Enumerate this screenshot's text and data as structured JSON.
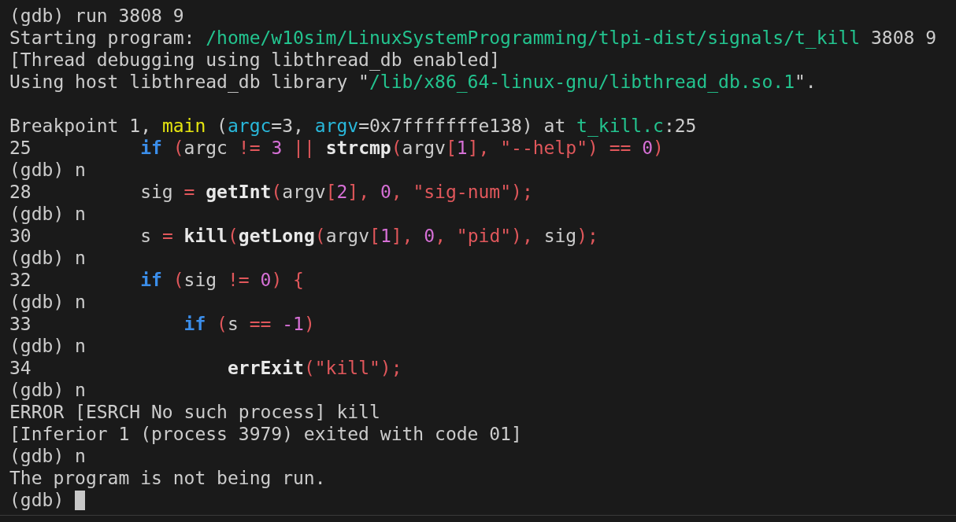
{
  "terminal": {
    "cursor_visible": true,
    "lines": [
      {
        "kind": "output",
        "segments": [
          {
            "text": "(gdb) run 3808 9",
            "kind": "plain"
          }
        ]
      },
      {
        "kind": "output",
        "segments": [
          {
            "text": "Starting program: ",
            "kind": "plain"
          },
          {
            "text": "/home/w10sim/LinuxSystemProgramming/tlpi-dist/signals/t_kill",
            "kind": "path"
          },
          {
            "text": " 3808 9",
            "kind": "plain"
          }
        ]
      },
      {
        "kind": "output",
        "segments": [
          {
            "text": "[Thread debugging using libthread_db enabled]",
            "kind": "plain"
          }
        ]
      },
      {
        "kind": "output",
        "segments": [
          {
            "text": "Using host libthread_db library \"",
            "kind": "plain"
          },
          {
            "text": "/lib/x86_64-linux-gnu/libthread_db.so.1",
            "kind": "path"
          },
          {
            "text": "\".",
            "kind": "plain"
          }
        ]
      },
      {
        "kind": "blank"
      },
      {
        "kind": "output",
        "segments": [
          {
            "text": "Breakpoint 1, ",
            "kind": "plain"
          },
          {
            "text": "main",
            "kind": "function"
          },
          {
            "text": " (",
            "kind": "plain"
          },
          {
            "text": "argc",
            "kind": "param"
          },
          {
            "text": "=3, ",
            "kind": "plain"
          },
          {
            "text": "argv",
            "kind": "param"
          },
          {
            "text": "=0x7fffffffe138) at ",
            "kind": "plain"
          },
          {
            "text": "t_kill.c",
            "kind": "path"
          },
          {
            "text": ":25",
            "kind": "plain"
          }
        ]
      },
      {
        "kind": "output",
        "segments": [
          {
            "text": "25          ",
            "kind": "plain"
          },
          {
            "text": "if",
            "kind": "keyword"
          },
          {
            "text": " (",
            "kind": "punct"
          },
          {
            "text": "argc ",
            "kind": "plain"
          },
          {
            "text": "!= ",
            "kind": "punct"
          },
          {
            "text": "3",
            "kind": "number"
          },
          {
            "text": " ||",
            "kind": "punct"
          },
          {
            "text": " strcmp",
            "kind": "bold"
          },
          {
            "text": "(",
            "kind": "punct"
          },
          {
            "text": "argv",
            "kind": "plain"
          },
          {
            "text": "[",
            "kind": "punct"
          },
          {
            "text": "1",
            "kind": "number"
          },
          {
            "text": "], \"--help\") == ",
            "kind": "punct"
          },
          {
            "text": "0",
            "kind": "number"
          },
          {
            "text": ")",
            "kind": "punct"
          }
        ]
      },
      {
        "kind": "output",
        "segments": [
          {
            "text": "(gdb) n",
            "kind": "plain"
          }
        ]
      },
      {
        "kind": "output",
        "segments": [
          {
            "text": "28          sig ",
            "kind": "plain"
          },
          {
            "text": "= ",
            "kind": "punct"
          },
          {
            "text": "getInt",
            "kind": "bold"
          },
          {
            "text": "(",
            "kind": "punct"
          },
          {
            "text": "argv",
            "kind": "plain"
          },
          {
            "text": "[",
            "kind": "punct"
          },
          {
            "text": "2",
            "kind": "number"
          },
          {
            "text": "], ",
            "kind": "punct"
          },
          {
            "text": "0",
            "kind": "number"
          },
          {
            "text": ", \"sig-num\");",
            "kind": "punct"
          }
        ]
      },
      {
        "kind": "output",
        "segments": [
          {
            "text": "(gdb) n",
            "kind": "plain"
          }
        ]
      },
      {
        "kind": "output",
        "segments": [
          {
            "text": "30          s ",
            "kind": "plain"
          },
          {
            "text": "= ",
            "kind": "punct"
          },
          {
            "text": "kill",
            "kind": "bold"
          },
          {
            "text": "(",
            "kind": "punct"
          },
          {
            "text": "getLong",
            "kind": "bold"
          },
          {
            "text": "(",
            "kind": "punct"
          },
          {
            "text": "argv",
            "kind": "plain"
          },
          {
            "text": "[",
            "kind": "punct"
          },
          {
            "text": "1",
            "kind": "number"
          },
          {
            "text": "], ",
            "kind": "punct"
          },
          {
            "text": "0",
            "kind": "number"
          },
          {
            "text": ", \"pid\"), ",
            "kind": "punct"
          },
          {
            "text": "sig",
            "kind": "plain"
          },
          {
            "text": ");",
            "kind": "punct"
          }
        ]
      },
      {
        "kind": "output",
        "segments": [
          {
            "text": "(gdb) n",
            "kind": "plain"
          }
        ]
      },
      {
        "kind": "output",
        "segments": [
          {
            "text": "32          ",
            "kind": "plain"
          },
          {
            "text": "if",
            "kind": "keyword"
          },
          {
            "text": " (",
            "kind": "punct"
          },
          {
            "text": "sig ",
            "kind": "plain"
          },
          {
            "text": "!= ",
            "kind": "punct"
          },
          {
            "text": "0",
            "kind": "number"
          },
          {
            "text": ") {",
            "kind": "punct"
          }
        ]
      },
      {
        "kind": "output",
        "segments": [
          {
            "text": "(gdb) n",
            "kind": "plain"
          }
        ]
      },
      {
        "kind": "output",
        "segments": [
          {
            "text": "33              ",
            "kind": "plain"
          },
          {
            "text": "if",
            "kind": "keyword"
          },
          {
            "text": " (",
            "kind": "punct"
          },
          {
            "text": "s ",
            "kind": "plain"
          },
          {
            "text": "== ",
            "kind": "punct"
          },
          {
            "text": "-1",
            "kind": "number"
          },
          {
            "text": ")",
            "kind": "punct"
          }
        ]
      },
      {
        "kind": "output",
        "segments": [
          {
            "text": "(gdb) n",
            "kind": "plain"
          }
        ]
      },
      {
        "kind": "output",
        "segments": [
          {
            "text": "34                  ",
            "kind": "plain"
          },
          {
            "text": "errExit",
            "kind": "bold"
          },
          {
            "text": "(\"kill\");",
            "kind": "punct"
          }
        ]
      },
      {
        "kind": "output",
        "segments": [
          {
            "text": "(gdb) n",
            "kind": "plain"
          }
        ]
      },
      {
        "kind": "output",
        "segments": [
          {
            "text": "ERROR [ESRCH No such process] kill",
            "kind": "plain"
          }
        ]
      },
      {
        "kind": "output",
        "segments": [
          {
            "text": "[Inferior 1 (process 3979) exited with code 01]",
            "kind": "plain"
          }
        ]
      },
      {
        "kind": "output",
        "segments": [
          {
            "text": "(gdb) n",
            "kind": "plain"
          }
        ]
      },
      {
        "kind": "output",
        "segments": [
          {
            "text": "The program is not being run.",
            "kind": "plain"
          }
        ]
      },
      {
        "kind": "output",
        "segments": [
          {
            "text": "(gdb) ",
            "kind": "plain"
          }
        ]
      }
    ]
  }
}
